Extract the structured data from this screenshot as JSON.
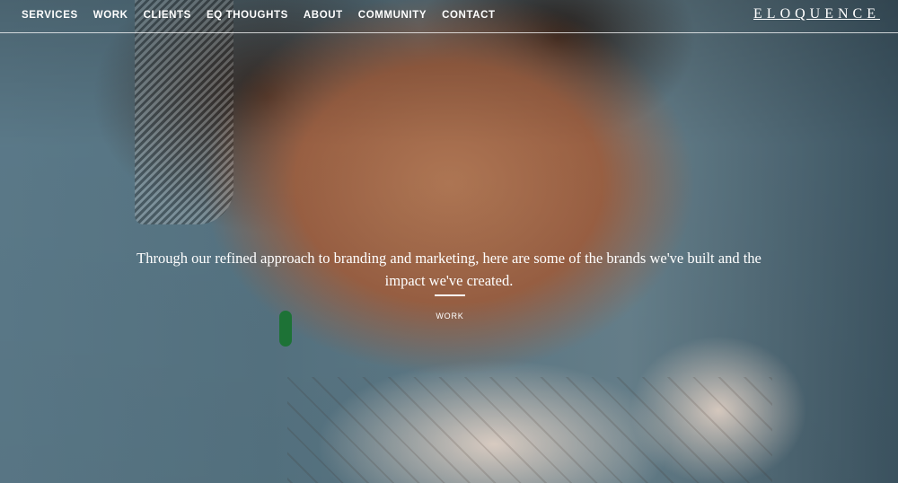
{
  "nav": {
    "items": [
      {
        "label": "SERVICES"
      },
      {
        "label": "WORK"
      },
      {
        "label": "CLIENTS"
      },
      {
        "label": "EQ THOUGHTS"
      },
      {
        "label": "ABOUT"
      },
      {
        "label": "COMMUNITY"
      },
      {
        "label": "CONTACT"
      }
    ]
  },
  "brand": {
    "logo_text": "ELOQUENCE"
  },
  "hero": {
    "intro_text": "Through our refined approach to branding and marketing, here are some of the brands we've built and the impact we've created.",
    "link_label": "WORK",
    "image_description": "hero-portrait-photo"
  },
  "colors": {
    "text": "#ffffff",
    "earring": "#1f7a3a"
  }
}
